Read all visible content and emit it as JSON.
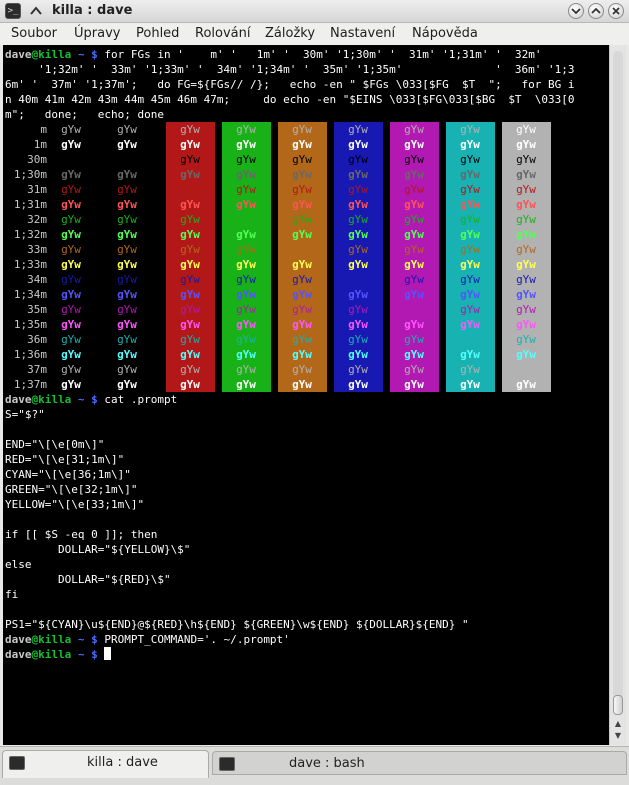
{
  "window": {
    "title": "killa : dave",
    "app_icon": "terminal-icon",
    "buttons": [
      "minimize",
      "maximize",
      "close"
    ]
  },
  "menu": [
    "Soubor",
    "Úpravy",
    "Pohled",
    "Rolování",
    "Záložky",
    "Nastavení",
    "Nápověda"
  ],
  "prompt": {
    "user": "dave",
    "host": "killa",
    "dir": "~",
    "sign": "$"
  },
  "commands": {
    "for_loop": [
      " for FGs in '    m' '   1m' '  30m' '1;30m' '  31m' '1;31m' '  32m'",
      "     '1;32m' '  33m' '1;33m' '  34m' '1;34m' '  35m' '1;35m'              '  36m' '1;3",
      "6m' '  37m' '1;37m';   do FG=${FGs// /};   echo -en \" $FGs \\033[$FG  $T  \";   for BG i",
      "n 40m 41m 42m 43m 44m 45m 46m 47m;     do echo -en \"$EINS \\033[$FG\\033[$BG  $T  \\033[0",
      "m\";   done;   echo; done"
    ],
    "cat": " cat .prompt",
    "prompt_command": " PROMPT_COMMAND='. ~/.prompt'"
  },
  "color_table": {
    "sample": "gYw",
    "fg_labels": [
      "m",
      "1m",
      "30m",
      "1;30m",
      "31m",
      "1;31m",
      "32m",
      "1;32m",
      "33m",
      "1;33m",
      "34m",
      "1;34m",
      "35m",
      "1;35m",
      "36m",
      "1;36m",
      "37m",
      "1;37m"
    ],
    "backgrounds": [
      "#000000",
      "#000000",
      "#b21818",
      "#18b218",
      "#b26818",
      "#1818b2",
      "#b218b2",
      "#18b2b2",
      "#b2b2b2"
    ],
    "fg_colors": [
      "#b2b2b2",
      "#ffffff",
      "#000000",
      "#686868",
      "#b21818",
      "#ff5454",
      "#18b218",
      "#54ff54",
      "#b26818",
      "#ffff54",
      "#1818b2",
      "#5454ff",
      "#b218b2",
      "#ff54ff",
      "#18b2b2",
      "#54ffff",
      "#b2b2b2",
      "#ffffff"
    ]
  },
  "file_content": [
    "S=\"$?\"",
    "",
    "END=\"\\[\\e[0m\\]\"",
    "RED=\"\\[\\e[31;1m\\]\"",
    "CYAN=\"\\[\\e[36;1m\\]\"",
    "GREEN=\"\\[\\e[32;1m\\]\"",
    "YELLOW=\"\\[\\e[33;1m\\]\"",
    "",
    "if [[ $S -eq 0 ]]; then",
    "        DOLLAR=\"${YELLOW}\\$\"",
    "else",
    "        DOLLAR=\"${RED}\\$\"",
    "fi",
    "",
    "PS1=\"${CYAN}\\u${END}@${RED}\\h${END} ${GREEN}\\w${END} ${DOLLAR}${END} \""
  ],
  "tabs": [
    {
      "label": "killa : dave",
      "active": true
    },
    {
      "label": "dave : bash",
      "active": false
    }
  ]
}
